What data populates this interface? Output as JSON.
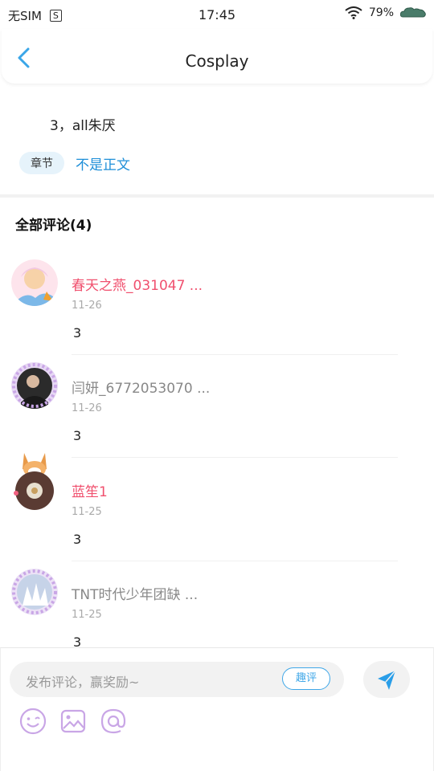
{
  "status_bar": {
    "carrier": "无SIM",
    "sim_glyph": "S",
    "time": "17:45",
    "battery": "79%"
  },
  "header": {
    "title": "Cosplay"
  },
  "chapter": {
    "text": "3，all朱厌",
    "tag": "章节",
    "link": "不是正文"
  },
  "comments_section": {
    "heading": "全部评论(4)"
  },
  "comments": [
    {
      "name": "春天之燕_031047 ...",
      "date": "11-26",
      "text": "3",
      "name_color": "pink"
    },
    {
      "name": "闫妍_6772053070 ...",
      "date": "11-26",
      "text": "3",
      "name_color": "gray"
    },
    {
      "name": "蓝笙1",
      "date": "11-25",
      "text": "3",
      "name_color": "pink"
    },
    {
      "name": "TNT时代少年团缺 ...",
      "date": "11-25",
      "text": "3",
      "name_color": "gray"
    }
  ],
  "composer": {
    "placeholder": "发布评论，赢奖励~",
    "quping_label": "趣评",
    "accent": "#3fa7e8"
  },
  "colors": {
    "link": "#1f8fd8",
    "pink_name": "#f0506e",
    "icon_purple": "#c9a6e6"
  }
}
